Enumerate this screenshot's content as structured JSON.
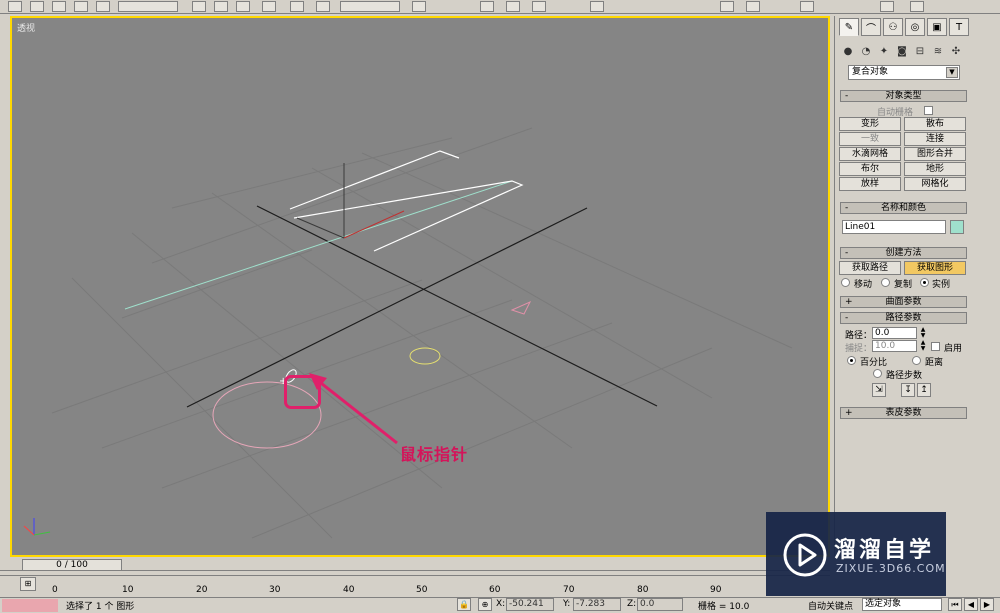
{
  "viewport": {
    "label": "透视"
  },
  "command_panel": {
    "category": "复合对象",
    "object_type": {
      "title": "对象类型",
      "autogrid_label": "自动栅格",
      "buttons": [
        "变形",
        "散布",
        "一致",
        "连接",
        "水滴网格",
        "图形合并",
        "布尔",
        "地形",
        "放样",
        "网格化"
      ]
    },
    "name_color": {
      "title": "名称和颜色",
      "name_value": "Line01",
      "swatch_color": "#9fe0cc"
    },
    "creation_method": {
      "title": "创建方法",
      "get_path_label": "获取路径",
      "get_shape_label": "获取图形",
      "move_label": "移动",
      "copy_label": "复制",
      "instance_label": "实例",
      "selected_option": "实例"
    },
    "surface_params": {
      "title": "曲面参数"
    },
    "path_params": {
      "title": "路径参数",
      "path_label": "路径：",
      "path_value": "0.0",
      "snap_label": "捕捉：",
      "snap_value": "10.0",
      "enable_label": "启用",
      "percent_label": "百分比",
      "distance_label": "距离",
      "path_steps_label": "路径步数",
      "selected_option": "百分比"
    },
    "skin_params": {
      "title": "表皮参数"
    }
  },
  "timeline": {
    "slider_text": "0 / 100",
    "ticks": [
      "0",
      "10",
      "20",
      "30",
      "40",
      "50",
      "60",
      "70",
      "80",
      "90"
    ]
  },
  "status": {
    "selection_text": "选择了 1 个 图形",
    "x_label": "X:",
    "x_value": "-50.241",
    "y_label": "Y:",
    "y_value": "-7.283",
    "z_label": "Z:",
    "z_value": "0.0",
    "grid_text": "栅格 = 10.0",
    "autokey_label": "自动关键点",
    "selection_filter": "选定对象"
  },
  "annotation": {
    "text": "鼠标指针",
    "color": "#d4145a"
  },
  "watermark": {
    "brand": "溜溜自学",
    "url": "ZIXUE.3D66.COM"
  },
  "colors": {
    "viewport_bg": "#858585",
    "active_border": "#ffd800",
    "panel_bg": "#d4d0c8"
  }
}
